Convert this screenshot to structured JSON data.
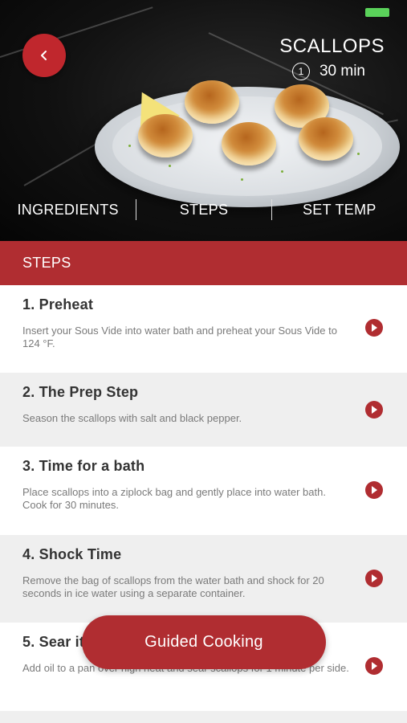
{
  "header": {
    "title": "SCALLOPS",
    "time": "30 min",
    "clock_glyph": "1"
  },
  "tabs": [
    {
      "label": "INGREDIENTS"
    },
    {
      "label": "STEPS"
    },
    {
      "label": "SET TEMP"
    }
  ],
  "section": {
    "title": "STEPS"
  },
  "steps": [
    {
      "title": "1. Preheat",
      "desc": "Insert your Sous Vide into water bath and preheat your Sous Vide to 124 °F."
    },
    {
      "title": "2. The Prep Step",
      "desc": "Season the scallops with salt and black pepper."
    },
    {
      "title": "3. Time for a bath",
      "desc": "Place scallops into a ziplock bag and gently place into water bath. Cook for 30 minutes."
    },
    {
      "title": "4. Shock Time",
      "desc": "Remove the bag of scallops from the water bath and shock for 20 seconds in ice water using a separate container."
    },
    {
      "title": "5. Sear it",
      "desc": "Add oil to a pan over high heat and sear scallops for 1 minute per side."
    }
  ],
  "guided_button": {
    "label": "Guided Cooking"
  },
  "icons": {
    "back": "chevron-left-icon",
    "clock": "clock-icon",
    "step_arrow": "play-arrow-icon",
    "battery": "battery-icon"
  },
  "colors": {
    "accent": "#b02d31",
    "back_button": "#c0272d",
    "battery": "#5ad25a",
    "alt_row": "#efefef"
  }
}
